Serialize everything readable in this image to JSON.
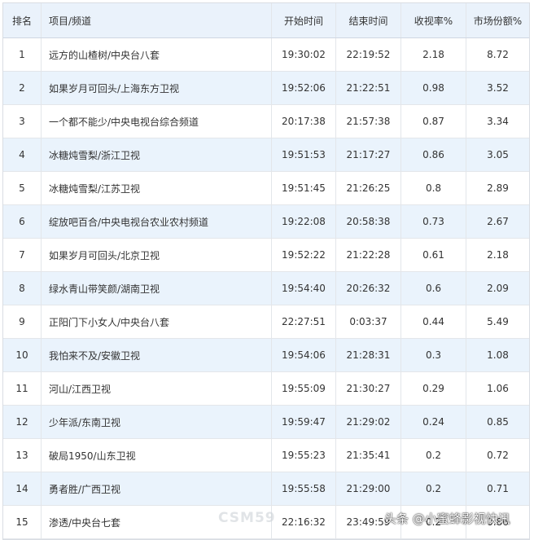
{
  "table": {
    "headers": {
      "rank": "排名",
      "name": "项目/频道",
      "start": "开始时间",
      "end": "结束时间",
      "rating": "收视率%",
      "share": "市场份额%"
    },
    "rows": [
      {
        "rank": "1",
        "name": "远方的山楂树/中央台八套",
        "start": "19:30:02",
        "end": "22:19:52",
        "rating": "2.18",
        "share": "8.72"
      },
      {
        "rank": "2",
        "name": "如果岁月可回头/上海东方卫视",
        "start": "19:52:06",
        "end": "21:22:51",
        "rating": "0.98",
        "share": "3.52"
      },
      {
        "rank": "3",
        "name": "一个都不能少/中央电视台综合频道",
        "start": "20:17:38",
        "end": "21:57:38",
        "rating": "0.87",
        "share": "3.34"
      },
      {
        "rank": "4",
        "name": "冰糖炖雪梨/浙江卫视",
        "start": "19:51:53",
        "end": "21:17:27",
        "rating": "0.86",
        "share": "3.05"
      },
      {
        "rank": "5",
        "name": "冰糖炖雪梨/江苏卫视",
        "start": "19:51:45",
        "end": "21:26:25",
        "rating": "0.8",
        "share": "2.89"
      },
      {
        "rank": "6",
        "name": "绽放吧百合/中央电视台农业农村频道",
        "start": "19:22:08",
        "end": "20:58:38",
        "rating": "0.73",
        "share": "2.67"
      },
      {
        "rank": "7",
        "name": "如果岁月可回头/北京卫视",
        "start": "19:52:22",
        "end": "21:22:28",
        "rating": "0.61",
        "share": "2.18"
      },
      {
        "rank": "8",
        "name": "绿水青山带笑颜/湖南卫视",
        "start": "19:54:40",
        "end": "20:26:32",
        "rating": "0.6",
        "share": "2.09"
      },
      {
        "rank": "9",
        "name": "正阳门下小女人/中央台八套",
        "start": "22:27:51",
        "end": "0:03:37",
        "rating": "0.44",
        "share": "5.49"
      },
      {
        "rank": "10",
        "name": "我怕来不及/安徽卫视",
        "start": "19:54:06",
        "end": "21:28:31",
        "rating": "0.3",
        "share": "1.08"
      },
      {
        "rank": "11",
        "name": "河山/江西卫视",
        "start": "19:55:09",
        "end": "21:30:27",
        "rating": "0.29",
        "share": "1.06"
      },
      {
        "rank": "12",
        "name": "少年派/东南卫视",
        "start": "19:59:47",
        "end": "21:29:02",
        "rating": "0.24",
        "share": "0.85"
      },
      {
        "rank": "13",
        "name": "破局1950/山东卫视",
        "start": "19:55:23",
        "end": "21:35:41",
        "rating": "0.2",
        "share": "0.72"
      },
      {
        "rank": "14",
        "name": "勇者胜/广西卫视",
        "start": "19:55:58",
        "end": "21:29:00",
        "rating": "0.2",
        "share": "0.71"
      },
      {
        "rank": "15",
        "name": "渗透/中央台七套",
        "start": "22:16:32",
        "end": "23:49:59",
        "rating": "0.2",
        "share": "0.86"
      }
    ]
  },
  "watermark": "CSM59",
  "source_tag": "头条 @小蜜蜂影视快讯",
  "colors": {
    "header_bg": "#eaf2fb",
    "stripe_bg": "#eaf3fc",
    "grid_line": "#e3e6ea",
    "text": "#333333"
  }
}
